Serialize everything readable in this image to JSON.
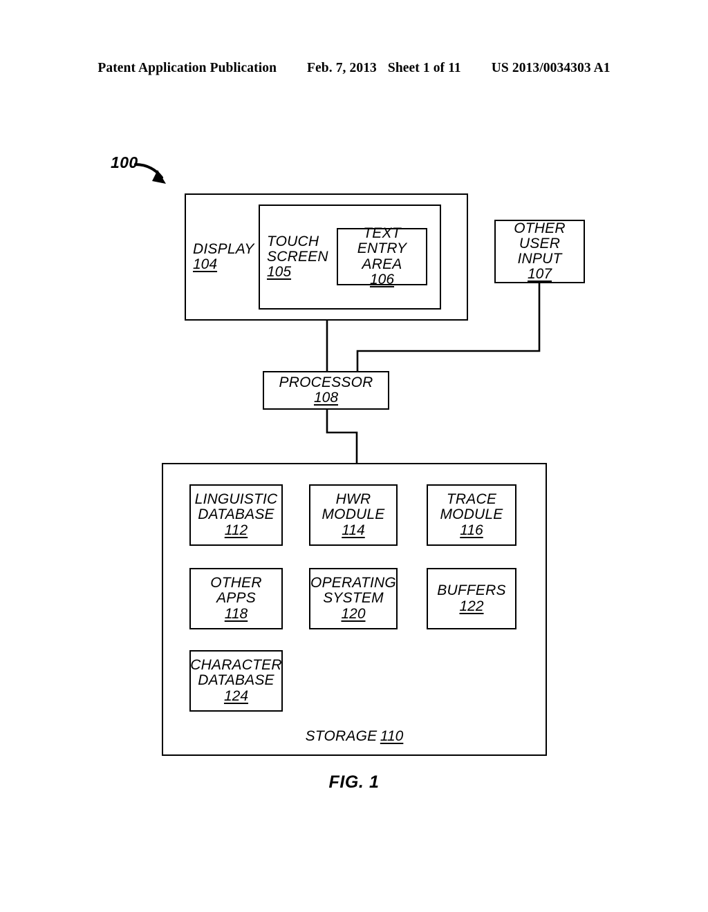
{
  "header": {
    "publication": "Patent Application Publication",
    "date": "Feb. 7, 2013",
    "sheet": "Sheet 1 of 11",
    "patent_number": "US 2013/0034303 A1"
  },
  "figure": {
    "caption": "FIG. 1",
    "system_callout": "100",
    "blocks": {
      "display": {
        "label": "DISPLAY",
        "ref": "104"
      },
      "touchscreen": {
        "label": "TOUCH\nSCREEN",
        "ref": "105"
      },
      "text_entry": {
        "label": "TEXT ENTRY\nAREA",
        "ref": "106"
      },
      "other_input": {
        "label": "OTHER USER\nINPUT",
        "ref": "107"
      },
      "processor": {
        "label": "PROCESSOR",
        "ref": "108"
      },
      "storage": {
        "label": "STORAGE",
        "ref": "110"
      },
      "linguistic_db": {
        "label": "LINGUISTIC\nDATABASE",
        "ref": "112"
      },
      "hwr_module": {
        "label": "HWR\nMODULE",
        "ref": "114"
      },
      "trace_module": {
        "label": "TRACE\nMODULE",
        "ref": "116"
      },
      "other_apps": {
        "label": "OTHER APPS",
        "ref": "118"
      },
      "operating_system": {
        "label": "OPERATING\nSYSTEM",
        "ref": "120"
      },
      "buffers": {
        "label": "BUFFERS",
        "ref": "122"
      },
      "character_db": {
        "label": "CHARACTER\nDATABASE",
        "ref": "124"
      }
    },
    "colors": {
      "ink": "#000000",
      "paper": "#ffffff"
    }
  }
}
